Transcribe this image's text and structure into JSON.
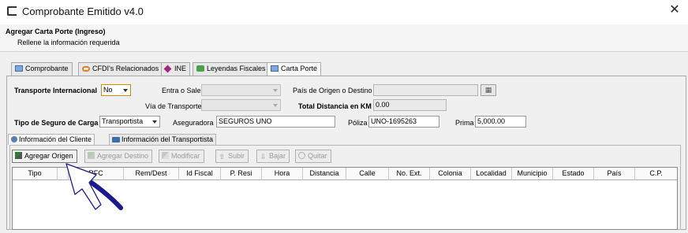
{
  "window": {
    "title": "Comprobante Emitido v4.0",
    "close_glyph": "✕"
  },
  "header": {
    "title": "Agregar Carta Porte (Ingreso)",
    "subtitle": "Rellene la información requerida"
  },
  "main_tabs": [
    {
      "label": "Comprobante",
      "icon": "document-icon"
    },
    {
      "label": "CFDI's Relacionados",
      "icon": "link-icon"
    },
    {
      "label": "INE",
      "icon": "diamond-icon"
    },
    {
      "label": "Leyendas Fiscales",
      "icon": "note-icon"
    },
    {
      "label": "Carta Porte",
      "icon": "document-icon"
    }
  ],
  "form": {
    "transporte_internacional_label": "Transporte Internacional",
    "transporte_internacional_value": "No",
    "entra_sale_label": "Entra o Sale",
    "entra_sale_value": "",
    "pais_label": "País de Origen o Destino",
    "pais_value": "",
    "via_label": "Vía de Transporte",
    "via_value": "",
    "total_distancia_label": "Total Distancia en KM",
    "total_distancia_value": "0.00",
    "tipo_seguro_label": "Tipo de Seguro de Carga",
    "tipo_seguro_value": "Transportista",
    "aseguradora_label": "Aseguradora",
    "aseguradora_value": "SEGUROS UNO",
    "poliza_label": "Póliza",
    "poliza_value": "UNO-1695263",
    "prima_label": "Prima",
    "prima_value": "5,000.00"
  },
  "sub_tabs": [
    {
      "label": "Información del Cliente",
      "icon": "user-icon"
    },
    {
      "label": "Información del Transportista",
      "icon": "truck-icon"
    }
  ],
  "toolbar": {
    "agregar_origen": "Agregar Origen",
    "agregar_destino": "Agregar Destino",
    "modificar": "Modificar",
    "subir": "Subir",
    "bajar": "Bajar",
    "quitar": "Quitar"
  },
  "table": {
    "columns": [
      "Tipo",
      "RFC",
      "Rem/Dest",
      "Id Fiscal",
      "P. Resi",
      "Hora",
      "Distancia",
      "Calle",
      "No. Ext.",
      "Colonia",
      "Localidad",
      "Municipio",
      "Estado",
      "País",
      "C.P."
    ],
    "rows": []
  },
  "colors": {
    "annotation_arrow": "#1a1a8c",
    "highlight_border": "#d48a00"
  }
}
